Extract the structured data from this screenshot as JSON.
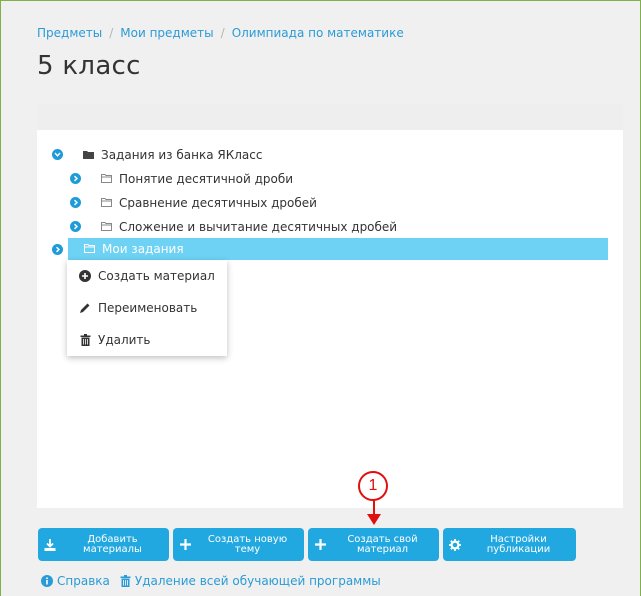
{
  "breadcrumb": {
    "items": [
      "Предметы",
      "Мои предметы",
      "Олимпиада по математике"
    ],
    "separator": "/"
  },
  "page_title": "5 класс",
  "tree": {
    "root": "Задания из банка ЯКласс",
    "children": [
      "Понятие десятичной дроби",
      "Сравнение десятичных дробей",
      "Сложение и вычитание десятичных дробей"
    ],
    "selected": "Мои задания"
  },
  "context_menu": {
    "items": [
      "Создать материал",
      "Переименовать",
      "Удалить"
    ]
  },
  "toolbar": {
    "buttons": [
      {
        "label": "Добавить\nматериалы",
        "icon": "download-icon"
      },
      {
        "label": "Создать новую\nтему",
        "icon": "plus-icon"
      },
      {
        "label": "Создать свой\nматериал",
        "icon": "plus-icon"
      },
      {
        "label": "Настройки\nпубликации",
        "icon": "gear-icon"
      }
    ]
  },
  "footer": {
    "help": "Справка",
    "delete_program": "Удаление всей обучающей программы"
  },
  "annotation": {
    "number": "1"
  },
  "colors": {
    "accent": "#22a8e0",
    "link": "#2a9bd6",
    "selection": "#6dd2f4",
    "annotation": "#e01010"
  }
}
